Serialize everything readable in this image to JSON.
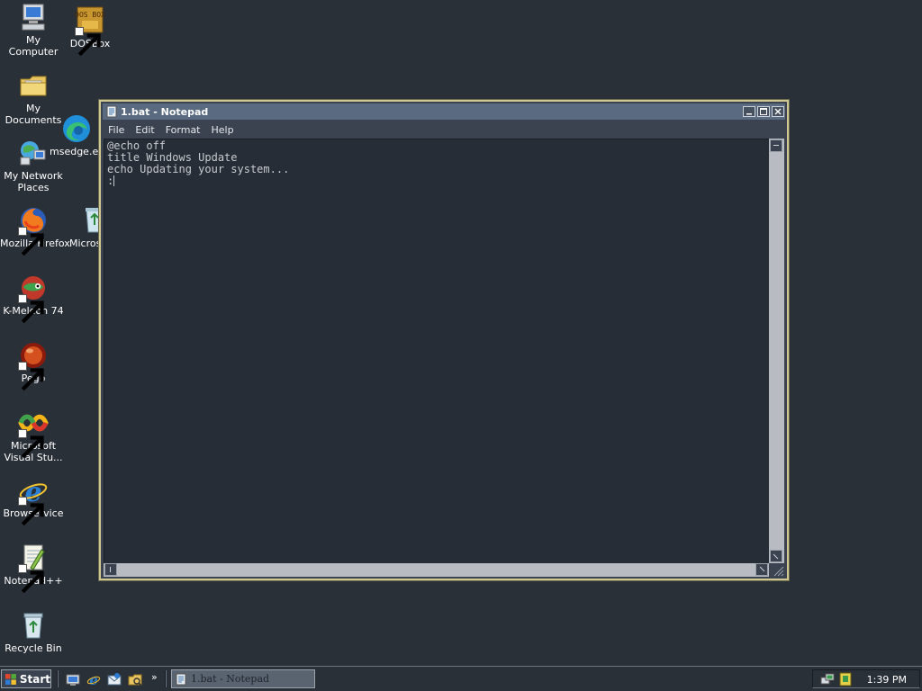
{
  "desktop": {
    "icons": [
      {
        "label": "My Computer",
        "icon": "computer-icon"
      },
      {
        "label": "DOSBox",
        "icon": "dosbox-icon",
        "art_text": "DOS BOX"
      },
      {
        "label": "My Documents",
        "icon": "folder-icon"
      },
      {
        "label": "msedge.exe",
        "icon": "edge-icon"
      },
      {
        "label": "My Network Places",
        "icon": "network-icon"
      },
      {
        "label": "Mozilla Firefox",
        "icon": "firefox-icon"
      },
      {
        "label": "Microsoft",
        "icon": "recycle-bin-partial-icon"
      },
      {
        "label": "K-Meleon 74",
        "icon": "k-meleon-icon"
      },
      {
        "label": "Pego",
        "icon": "pego-icon"
      },
      {
        "label": "Microsoft Visual Stu...",
        "icon": "visual-studio-icon"
      },
      {
        "label": "Browservice",
        "icon": "internet-explorer-icon"
      },
      {
        "label": "Notepad++",
        "icon": "notepad-plus-plus-icon"
      },
      {
        "label": "Recycle Bin",
        "icon": "recycle-bin-icon"
      }
    ]
  },
  "notepad": {
    "title": "1.bat - Notepad",
    "menus": [
      "File",
      "Edit",
      "Format",
      "Help"
    ],
    "lines": [
      "@echo off",
      "title Windows Update",
      "echo Updating your system...",
      ":"
    ]
  },
  "taskbar": {
    "start_label": "Start",
    "quick_launch": [
      "show-desktop-icon",
      "internet-explorer-icon",
      "outlook-express-icon",
      "explorer-icon"
    ],
    "chevron": "»",
    "tasks": [
      {
        "label": "1.bat - Notepad",
        "icon": "notepad-icon"
      }
    ],
    "tray_icons": [
      "network-tray-icon",
      "security-tray-icon"
    ],
    "clock": "1:39 PM"
  },
  "colors": {
    "desktop_background": "#2a3038",
    "titlebar": "#5a6a80",
    "window_border": "#d0c890",
    "editor_background": "#262d36",
    "editor_text": "#c8cbd0"
  }
}
